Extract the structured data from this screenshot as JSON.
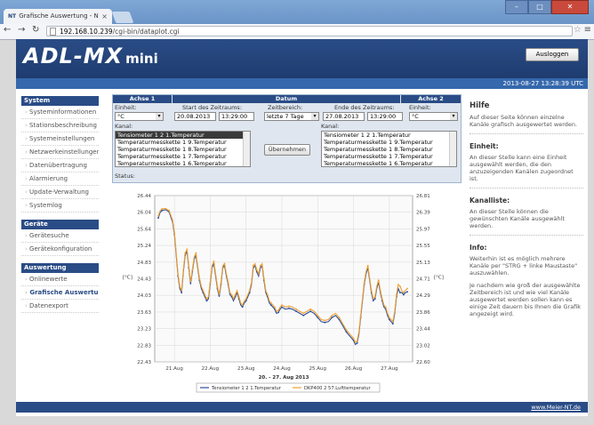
{
  "browser": {
    "tab_title": "Grafische Auswertung - N",
    "tab_icon_text": "NT",
    "address_host": "192.168.10.239",
    "address_path": "/cgi-bin/dataplot.cgi"
  },
  "header": {
    "logo_main": "ADL-MX",
    "logo_sub": "mini",
    "logout_label": "Ausloggen",
    "datetime": "2013-08-27 13:28:39 UTC"
  },
  "sidebar": {
    "sections": [
      {
        "title": "System",
        "items": [
          "Systeminformationen",
          "Stationsbeschreibung",
          "Systemeinstellungen",
          "Netzwerkeinstellungen",
          "Datenübertragung",
          "Alarmierung",
          "Update-Verwaltung",
          "Systemlog"
        ]
      },
      {
        "title": "Geräte",
        "items": [
          "Gerätesuche",
          "Gerätekonfiguration"
        ]
      },
      {
        "title": "Auswertung",
        "items": [
          "Onlinewerte",
          "Grafische Auswertung",
          "Datenexport"
        ],
        "active": "Grafische Auswertung"
      }
    ]
  },
  "form": {
    "axis1_title": "Achse 1",
    "date_title": "Datum",
    "axis2_title": "Achse 2",
    "unit_label": "Einheit:",
    "unit_value": "°C",
    "start_label": "Start des Zeitraums:",
    "start_date": "20.08.2013",
    "start_time": "13:29:00",
    "range_label": "Zeitbereich:",
    "range_value": "letzte 7 Tage",
    "end_label": "Ende des Zeitraums:",
    "end_date": "27.08.2013",
    "end_time": "13:29:00",
    "unit2_value": "°C",
    "channel_label": "Kanal:",
    "channels": [
      "Tensiometer 1 2 1.Temperatur",
      "Temperaturmesskette 1 9.Temperatur",
      "Temperaturmesskette 1 8.Temperatur",
      "Temperaturmesskette 1 7.Temperatur",
      "Temperaturmesskette 1 6.Temperatur"
    ],
    "apply_label": "Übernehmen",
    "status_label": "Status:"
  },
  "chart_data": {
    "type": "line",
    "xlabel": "20. - 27. Aug 2013",
    "ylabel": "[°C]",
    "ylabel_right": "[°C]",
    "ylim": [
      22.43,
      26.44
    ],
    "ylim_right": [
      22.6,
      26.81
    ],
    "y_ticks": [
      "26.44",
      "26.04",
      "25.64",
      "25.24",
      "24.83",
      "24.43",
      "24.03",
      "23.63",
      "23.23",
      "22.83",
      "22.43"
    ],
    "y_ticks_right": [
      "26.81",
      "26.39",
      "25.97",
      "25.55",
      "25.13",
      "24.71",
      "24.29",
      "23.86",
      "23.44",
      "23.02",
      "22.60"
    ],
    "x_ticks": [
      "21.Aug",
      "22.Aug",
      "23.Aug",
      "24.Aug",
      "25.Aug",
      "26.Aug",
      "27.Aug"
    ],
    "grid": true,
    "legend_position": "bottom",
    "series": [
      {
        "name": "Tensiometer 1 2 1.Temperatur",
        "axis": "left",
        "color": "#2c4e9a",
        "x": [
          20.55,
          20.6,
          20.65,
          20.75,
          20.85,
          20.95,
          21.0,
          21.05,
          21.1,
          21.15,
          21.2,
          21.25,
          21.3,
          21.35,
          21.4,
          21.45,
          21.5,
          21.55,
          21.6,
          21.65,
          21.7,
          21.75,
          21.8,
          21.85,
          21.9,
          21.95,
          22.0,
          22.05,
          22.1,
          22.15,
          22.2,
          22.25,
          22.3,
          22.35,
          22.4,
          22.45,
          22.5,
          22.55,
          22.6,
          22.65,
          22.7,
          22.75,
          22.8,
          22.85,
          22.9,
          22.95,
          23.0,
          23.05,
          23.1,
          23.15,
          23.2,
          23.25,
          23.3,
          23.35,
          23.4,
          23.45,
          23.5,
          23.55,
          23.6,
          23.65,
          23.7,
          23.75,
          23.8,
          23.85,
          23.9,
          23.95,
          24.0,
          24.1,
          24.2,
          24.3,
          24.4,
          24.5,
          24.6,
          24.7,
          24.8,
          24.9,
          25.0,
          25.1,
          25.2,
          25.3,
          25.4,
          25.5,
          25.6,
          25.7,
          25.8,
          25.9,
          26.0,
          26.05,
          26.1,
          26.15,
          26.2,
          26.25,
          26.3,
          26.35,
          26.4,
          26.45,
          26.5,
          26.55,
          26.6,
          26.65,
          26.7,
          26.75,
          26.8,
          26.85,
          26.9,
          26.95,
          27.0,
          27.05,
          27.1,
          27.15,
          27.2,
          27.25,
          27.3,
          27.35,
          27.4,
          27.45,
          27.5
        ],
        "y": [
          25.9,
          26.03,
          26.08,
          26.1,
          26.05,
          25.8,
          25.5,
          25.0,
          24.5,
          24.2,
          24.1,
          24.6,
          25.0,
          25.1,
          24.7,
          24.3,
          24.6,
          24.9,
          25.0,
          24.7,
          24.4,
          24.2,
          24.1,
          24.0,
          23.9,
          23.95,
          24.3,
          24.7,
          24.8,
          24.5,
          24.2,
          24.0,
          24.3,
          24.7,
          24.75,
          24.5,
          24.3,
          24.05,
          24.0,
          23.9,
          24.0,
          24.1,
          23.95,
          23.8,
          23.75,
          23.85,
          23.9,
          24.0,
          24.1,
          24.3,
          24.7,
          24.75,
          24.6,
          24.5,
          24.7,
          24.75,
          24.4,
          24.1,
          24.0,
          23.85,
          23.8,
          23.75,
          23.7,
          23.6,
          23.62,
          23.7,
          23.75,
          23.7,
          23.72,
          23.7,
          23.65,
          23.6,
          23.55,
          23.6,
          23.65,
          23.6,
          23.5,
          23.4,
          23.38,
          23.4,
          23.5,
          23.55,
          23.45,
          23.3,
          23.15,
          23.05,
          22.95,
          22.85,
          22.88,
          23.1,
          23.5,
          23.9,
          24.3,
          24.55,
          24.7,
          24.4,
          24.1,
          23.9,
          23.95,
          24.2,
          24.35,
          24.1,
          23.9,
          23.75,
          23.7,
          23.55,
          23.45,
          23.4,
          23.35,
          23.6,
          24.0,
          24.2,
          24.1,
          24.1,
          24.05,
          24.1,
          24.12
        ]
      },
      {
        "name": "DKP400 2 57.Lufttemperatur",
        "axis": "left",
        "color": "#f0a030",
        "x": [
          20.55,
          20.6,
          20.65,
          20.75,
          20.85,
          20.95,
          21.0,
          21.05,
          21.1,
          21.15,
          21.2,
          21.25,
          21.3,
          21.35,
          21.4,
          21.45,
          21.5,
          21.55,
          21.6,
          21.65,
          21.7,
          21.75,
          21.8,
          21.85,
          21.9,
          21.95,
          22.0,
          22.05,
          22.1,
          22.15,
          22.2,
          22.25,
          22.3,
          22.35,
          22.4,
          22.45,
          22.5,
          22.55,
          22.6,
          22.65,
          22.7,
          22.75,
          22.8,
          22.85,
          22.9,
          22.95,
          23.0,
          23.05,
          23.1,
          23.15,
          23.2,
          23.25,
          23.3,
          23.35,
          23.4,
          23.45,
          23.5,
          23.55,
          23.6,
          23.65,
          23.7,
          23.75,
          23.8,
          23.85,
          23.9,
          23.95,
          24.0,
          24.1,
          24.2,
          24.3,
          24.4,
          24.5,
          24.6,
          24.7,
          24.8,
          24.9,
          25.0,
          25.1,
          25.2,
          25.3,
          25.4,
          25.5,
          25.6,
          25.7,
          25.8,
          25.9,
          26.0,
          26.05,
          26.1,
          26.15,
          26.2,
          26.25,
          26.3,
          26.35,
          26.4,
          26.45,
          26.5,
          26.55,
          26.6,
          26.65,
          26.7,
          26.75,
          26.8,
          26.85,
          26.9,
          26.95,
          27.0,
          27.05,
          27.1,
          27.15,
          27.2,
          27.25,
          27.3,
          27.35,
          27.4,
          27.45,
          27.5
        ],
        "y": [
          25.95,
          26.07,
          26.12,
          26.13,
          26.08,
          25.85,
          25.55,
          25.05,
          24.55,
          24.25,
          24.15,
          24.65,
          25.05,
          25.15,
          24.75,
          24.35,
          24.65,
          24.95,
          25.05,
          24.75,
          24.45,
          24.25,
          24.15,
          24.05,
          23.95,
          24.0,
          24.35,
          24.75,
          24.85,
          24.55,
          24.25,
          24.05,
          24.35,
          24.75,
          24.8,
          24.55,
          24.35,
          24.1,
          24.05,
          23.95,
          24.05,
          24.15,
          24.0,
          23.85,
          23.8,
          23.9,
          23.95,
          24.05,
          24.15,
          24.35,
          24.75,
          24.8,
          24.65,
          24.55,
          24.75,
          24.8,
          24.45,
          24.15,
          24.05,
          23.9,
          23.85,
          23.8,
          23.75,
          23.65,
          23.67,
          23.75,
          23.8,
          23.75,
          23.77,
          23.75,
          23.7,
          23.65,
          23.6,
          23.65,
          23.7,
          23.65,
          23.55,
          23.45,
          23.43,
          23.45,
          23.55,
          23.6,
          23.5,
          23.35,
          23.2,
          23.1,
          23.0,
          22.9,
          22.93,
          23.15,
          23.55,
          23.95,
          24.35,
          24.6,
          24.75,
          24.45,
          24.15,
          23.95,
          24.0,
          24.25,
          24.4,
          24.15,
          23.95,
          23.8,
          23.75,
          23.6,
          23.5,
          23.45,
          23.4,
          23.65,
          24.05,
          24.3,
          24.25,
          24.15,
          24.1,
          24.15,
          24.2
        ]
      }
    ]
  },
  "help": {
    "title": "Hilfe",
    "intro": "Auf dieser Seite können einzelne Kanäle grafisch ausgewertet werden.",
    "unit_title": "Einheit:",
    "unit_text": "An dieser Stelle kann eine Einheit ausgewählt werden, die den anzuzeigenden Kanälen zugeordnet ist.",
    "channels_title": "Kanalliste:",
    "channels_text": "An dieser Stelle können die gewünschten Kanäle ausgewählt werden.",
    "info_title": "Info:",
    "info_text1": "Weiterhin ist es möglich mehrere Kanäle per \"STRG + linke Maustaste\" auszuwählen.",
    "info_text2": "Je nachdem wie groß der ausgewählte Zeitbereich ist und wie viel Kanäle ausgewertet werden sollen kann es einige Zeit dauern bis Ihnen die Grafik angezeigt wird."
  },
  "footer": {
    "link": "www.Meier-NT.de"
  }
}
